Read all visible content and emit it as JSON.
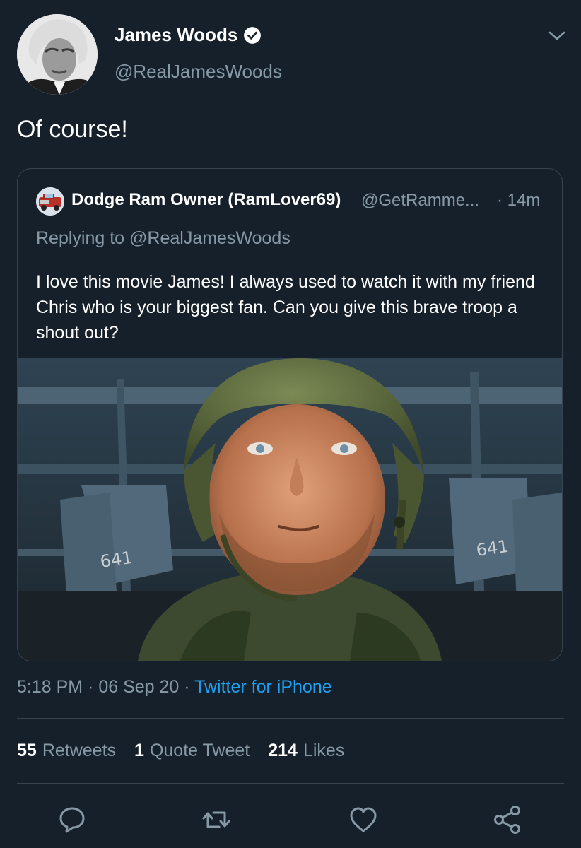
{
  "author": {
    "display_name": "James Woods",
    "handle": "@RealJamesWoods",
    "verified": true
  },
  "tweet": {
    "text": "Of course!"
  },
  "quoted_tweet": {
    "display_name": "Dodge Ram Owner (RamLover69)",
    "handle": "@GetRamme...",
    "time": "· 14m",
    "replying_to": "Replying to @RealJamesWoods",
    "body": "I love this movie James! I always used to watch it with my friend Chris who is your biggest fan. Can you give this brave troop a shout out?",
    "helmet_marks": [
      "641",
      "641"
    ]
  },
  "meta": {
    "time": "5:18 PM",
    "sep1": " · ",
    "date": "06 Sep 20",
    "sep2": " · ",
    "source": "Twitter for iPhone"
  },
  "stats": {
    "retweets_count": "55",
    "retweets_label": "Retweets",
    "quotes_count": "1",
    "quotes_label": "Quote Tweet",
    "likes_count": "214",
    "likes_label": "Likes"
  },
  "actions": [
    "reply-icon",
    "retweet-icon",
    "like-icon",
    "share-icon"
  ],
  "colors": {
    "background": "#15202b",
    "secondary_text": "#8899a6",
    "link": "#1da1f2",
    "border": "#38444d",
    "verified_badge": "#ffffff"
  }
}
